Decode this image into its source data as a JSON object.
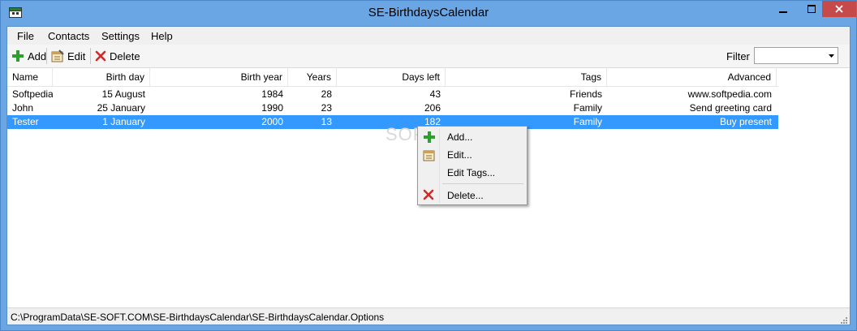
{
  "window": {
    "title": "SE-BirthdaysCalendar"
  },
  "menu": {
    "file": "File",
    "contacts": "Contacts",
    "settings": "Settings",
    "help": "Help"
  },
  "toolbar": {
    "add": "Add",
    "edit": "Edit",
    "delete": "Delete",
    "filter_label": "Filter",
    "filter_value": ""
  },
  "columns": {
    "name": "Name",
    "birth_day": "Birth day",
    "birth_year": "Birth year",
    "years": "Years",
    "days_left": "Days left",
    "tags": "Tags",
    "advanced": "Advanced"
  },
  "rows": [
    {
      "name": "Softpedia",
      "birth_day": "15 August",
      "birth_year": "1984",
      "years": "28",
      "days_left": "43",
      "tags": "Friends",
      "advanced": "www.softpedia.com"
    },
    {
      "name": "John",
      "birth_day": "25 January",
      "birth_year": "1990",
      "years": "23",
      "days_left": "206",
      "tags": "Family",
      "advanced": "Send greeting card"
    },
    {
      "name": "Tester",
      "birth_day": "1 January",
      "birth_year": "2000",
      "years": "13",
      "days_left": "182",
      "tags": "Family",
      "advanced": "Buy present",
      "selected": true
    }
  ],
  "watermark": "SOFTPEDIA",
  "context_menu": {
    "add": "Add...",
    "edit": "Edit...",
    "edit_tags": "Edit Tags...",
    "delete": "Delete..."
  },
  "statusbar": {
    "path": "C:\\ProgramData\\SE-SOFT.COM\\SE-BirthdaysCalendar\\SE-BirthdaysCalendar.Options"
  },
  "colors": {
    "titlebar": "#6aa6e4",
    "selection": "#3399ff",
    "close_button": "#c74a4a"
  },
  "icons": {
    "app": "calendar-icon",
    "add": "plus-icon",
    "edit": "notepad-icon",
    "delete": "x-icon"
  }
}
